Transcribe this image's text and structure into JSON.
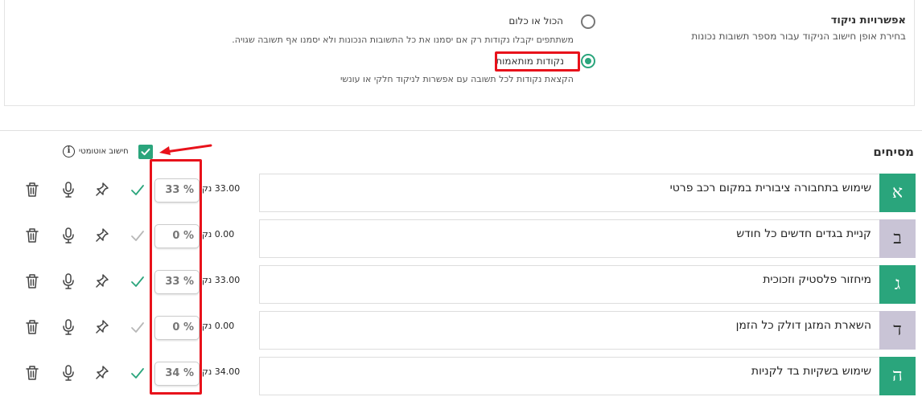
{
  "scoring": {
    "title": "אפשרויות ניקוד",
    "subtitle": "בחירת אופן חישוב הניקוד עבור מספר תשובות נכונות",
    "options": [
      {
        "label": "הכול או כלום",
        "description": "משתתפים יקבלו נקודות רק אם יסמנו את כל התשובות הנכונות ולא יסמנו אף תשובה שגויה.",
        "selected": false
      },
      {
        "label": "נקודות מותאמות",
        "description": "הקצאת נקודות לכל תשובה עם אפשרות לניקוד חלקי או עונשי",
        "selected": true
      }
    ]
  },
  "answers_section": {
    "title": "מסיחים",
    "auto_calc_label": "חישוב אוטומטי",
    "auto_calc_checked": true,
    "info_glyph": "i"
  },
  "answers": [
    {
      "letter": "א",
      "text": "שימוש בתחבורה ציבורית במקום רכב פרטי",
      "points": "33.00 נק'",
      "percent": "33 %",
      "correct": true
    },
    {
      "letter": "ב",
      "text": "קניית בגדים חדשים כל חודש",
      "points": "0.00 נק'",
      "percent": "0 %",
      "correct": false
    },
    {
      "letter": "ג",
      "text": "מיחזור פלסטיק וזכוכית",
      "points": "33.00 נק'",
      "percent": "33 %",
      "correct": true
    },
    {
      "letter": "ד",
      "text": "השארת המזגן דולק כל הזמן",
      "points": "0.00 נק'",
      "percent": "0 %",
      "correct": false
    },
    {
      "letter": "ה",
      "text": "שימוש בשקיות בד לקניות",
      "points": "34.00 נק'",
      "percent": "34 %",
      "correct": true
    }
  ],
  "colors": {
    "accent_green": "#2aa57c",
    "wrong_letter_bg": "#c9c4d6",
    "highlight_red": "#e8121b"
  },
  "icons": [
    "info-icon",
    "checkmark-icon",
    "pin-icon",
    "microphone-icon",
    "trash-icon",
    "radio-icon"
  ]
}
